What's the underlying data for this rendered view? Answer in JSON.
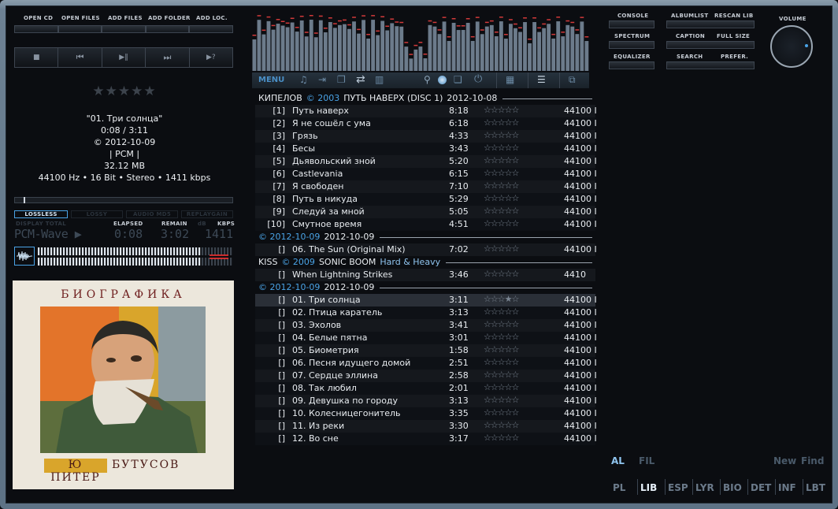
{
  "toolbar": {
    "open_cd": "OPEN CD",
    "open_files": "OPEN FILES",
    "add_files": "ADD FILES",
    "add_folder": "ADD FOLDER",
    "add_loc": "ADD LOC."
  },
  "transport": {
    "stop": "■",
    "prev": "⏮",
    "playpause": "▶‖",
    "next": "⏭",
    "random": "▶?"
  },
  "track_info": {
    "rating": "★★★★★",
    "title": "\"01. Три солнца\"",
    "time": "0:08 / 3:11",
    "copyright": "© 2012-10-09",
    "codec": "| PCM |",
    "size": "32.12 MB",
    "format": "44100 Hz • 16 Bit •  Stereo • 1411 kbps"
  },
  "status": {
    "lossless": "LOSSLESS",
    "lossy": "LOSSY",
    "audio_md5": "AUDIO MD5",
    "replaygain": "REPLAYGAIN",
    "display_labels": "DISPLAY  TOTAL",
    "elapsed_label": "ELAPSED",
    "remain_label": "REMAIN",
    "kbps_label": "KBPS",
    "db_label": "dB",
    "codec_display": "PCM-Wave ▶",
    "elapsed": "0:08",
    "remain": "3:02",
    "kbps": "1411"
  },
  "seek_position": 0.04,
  "album_art": {
    "top_text": "БИОГРАФИКА",
    "bottom_left": "Ю ПИТЕР",
    "bottom_right": "БУТУСОВ"
  },
  "menu": {
    "label": "MENU"
  },
  "right_panel": {
    "console": "CONSOLE",
    "albumlist": "ALBUMLIST",
    "rescan": "RESCAN LIB",
    "spectrum": "SPECTRUM",
    "caption": "CAPTION",
    "fullsize": "FULL SIZE",
    "equalizer": "EQUALIZER",
    "search": "SEARCH",
    "prefer": "PREFER.",
    "volume": "VOLUME",
    "al": "AL",
    "fil": "FIL",
    "new": "New",
    "find": "Find",
    "tabs": [
      "PL",
      "LIB",
      "ESP",
      "LYR",
      "BIO",
      "DET",
      "INF",
      "LBT"
    ]
  },
  "playlist": {
    "groups": [
      {
        "artist": "КИПЕЛОВ",
        "year": "© 2003",
        "album": "ПУТЬ НАВЕРХ (DISC 1)",
        "date": "2012-10-08",
        "tracks": [
          {
            "num": "[1]",
            "title": "Путь наверх",
            "dur": "8:18",
            "rate": "44100 I"
          },
          {
            "num": "[2]",
            "title": "Я не сошёл с ума",
            "dur": "6:18",
            "rate": "44100 I"
          },
          {
            "num": "[3]",
            "title": "Грязь",
            "dur": "4:33",
            "rate": "44100 I"
          },
          {
            "num": "[4]",
            "title": "Бесы",
            "dur": "3:43",
            "rate": "44100 I"
          },
          {
            "num": "[5]",
            "title": "Дьявольский зной",
            "dur": "5:20",
            "rate": "44100 I"
          },
          {
            "num": "[6]",
            "title": "Castlevania",
            "dur": "6:15",
            "rate": "44100 I"
          },
          {
            "num": "[7]",
            "title": "Я свободен",
            "dur": "7:10",
            "rate": "44100 I"
          },
          {
            "num": "[8]",
            "title": "Путь в никуда",
            "dur": "5:29",
            "rate": "44100 I"
          },
          {
            "num": "[9]",
            "title": "Следуй за мной",
            "dur": "5:05",
            "rate": "44100 I"
          },
          {
            "num": "[10]",
            "title": "Смутное время",
            "dur": "4:51",
            "rate": "44100 I"
          }
        ]
      },
      {
        "artist": "",
        "year": "© 2012-10-09",
        "album": "2012-10-09",
        "date": "",
        "tracks": [
          {
            "num": "[]",
            "title": "06. The Sun (Original Mix)",
            "dur": "7:02",
            "rate": "44100 I"
          }
        ]
      },
      {
        "artist": "KISS",
        "year": "© 2009",
        "album": "SONIC BOOM",
        "genre": "Hard & Heavy",
        "date": "",
        "tracks": [
          {
            "num": "[]",
            "title": "When Lightning Strikes",
            "dur": "3:46",
            "rate": "4410"
          }
        ]
      },
      {
        "artist": "",
        "year": "© 2012-10-09",
        "album": "2012-10-09",
        "date": "",
        "tracks": [
          {
            "num": "[]",
            "title": "01. Три солнца",
            "dur": "3:11",
            "rate": "44100 I",
            "playing": true
          },
          {
            "num": "[]",
            "title": "02. Птица каратель",
            "dur": "3:13",
            "rate": "44100 I"
          },
          {
            "num": "[]",
            "title": "03. Эхолов",
            "dur": "3:41",
            "rate": "44100 I"
          },
          {
            "num": "[]",
            "title": "04. Белые пятна",
            "dur": "3:01",
            "rate": "44100 I"
          },
          {
            "num": "[]",
            "title": "05. Биометрия",
            "dur": "1:58",
            "rate": "44100 I"
          },
          {
            "num": "[]",
            "title": "06. Песня идущего домой",
            "dur": "2:51",
            "rate": "44100 I"
          },
          {
            "num": "[]",
            "title": "07. Сердце эллина",
            "dur": "2:58",
            "rate": "44100 I"
          },
          {
            "num": "[]",
            "title": "08. Так любил",
            "dur": "2:01",
            "rate": "44100 I"
          },
          {
            "num": "[]",
            "title": "09. Девушка по городу",
            "dur": "3:13",
            "rate": "44100 I"
          },
          {
            "num": "[]",
            "title": "10. Колесницегонитель",
            "dur": "3:35",
            "rate": "44100 I"
          },
          {
            "num": "[]",
            "title": "11. Из реки",
            "dur": "3:30",
            "rate": "44100 I"
          },
          {
            "num": "[]",
            "title": "12. Во сне",
            "dur": "3:17",
            "rate": "44100 I"
          }
        ]
      }
    ]
  },
  "stars_empty": "☆☆☆☆☆",
  "stars_partial": "☆☆☆★☆",
  "colors": {
    "accent": "#4aa3e6",
    "background": "#0b0d11",
    "spectrum": "#8ea0b4",
    "peak": "#d23a3a"
  }
}
